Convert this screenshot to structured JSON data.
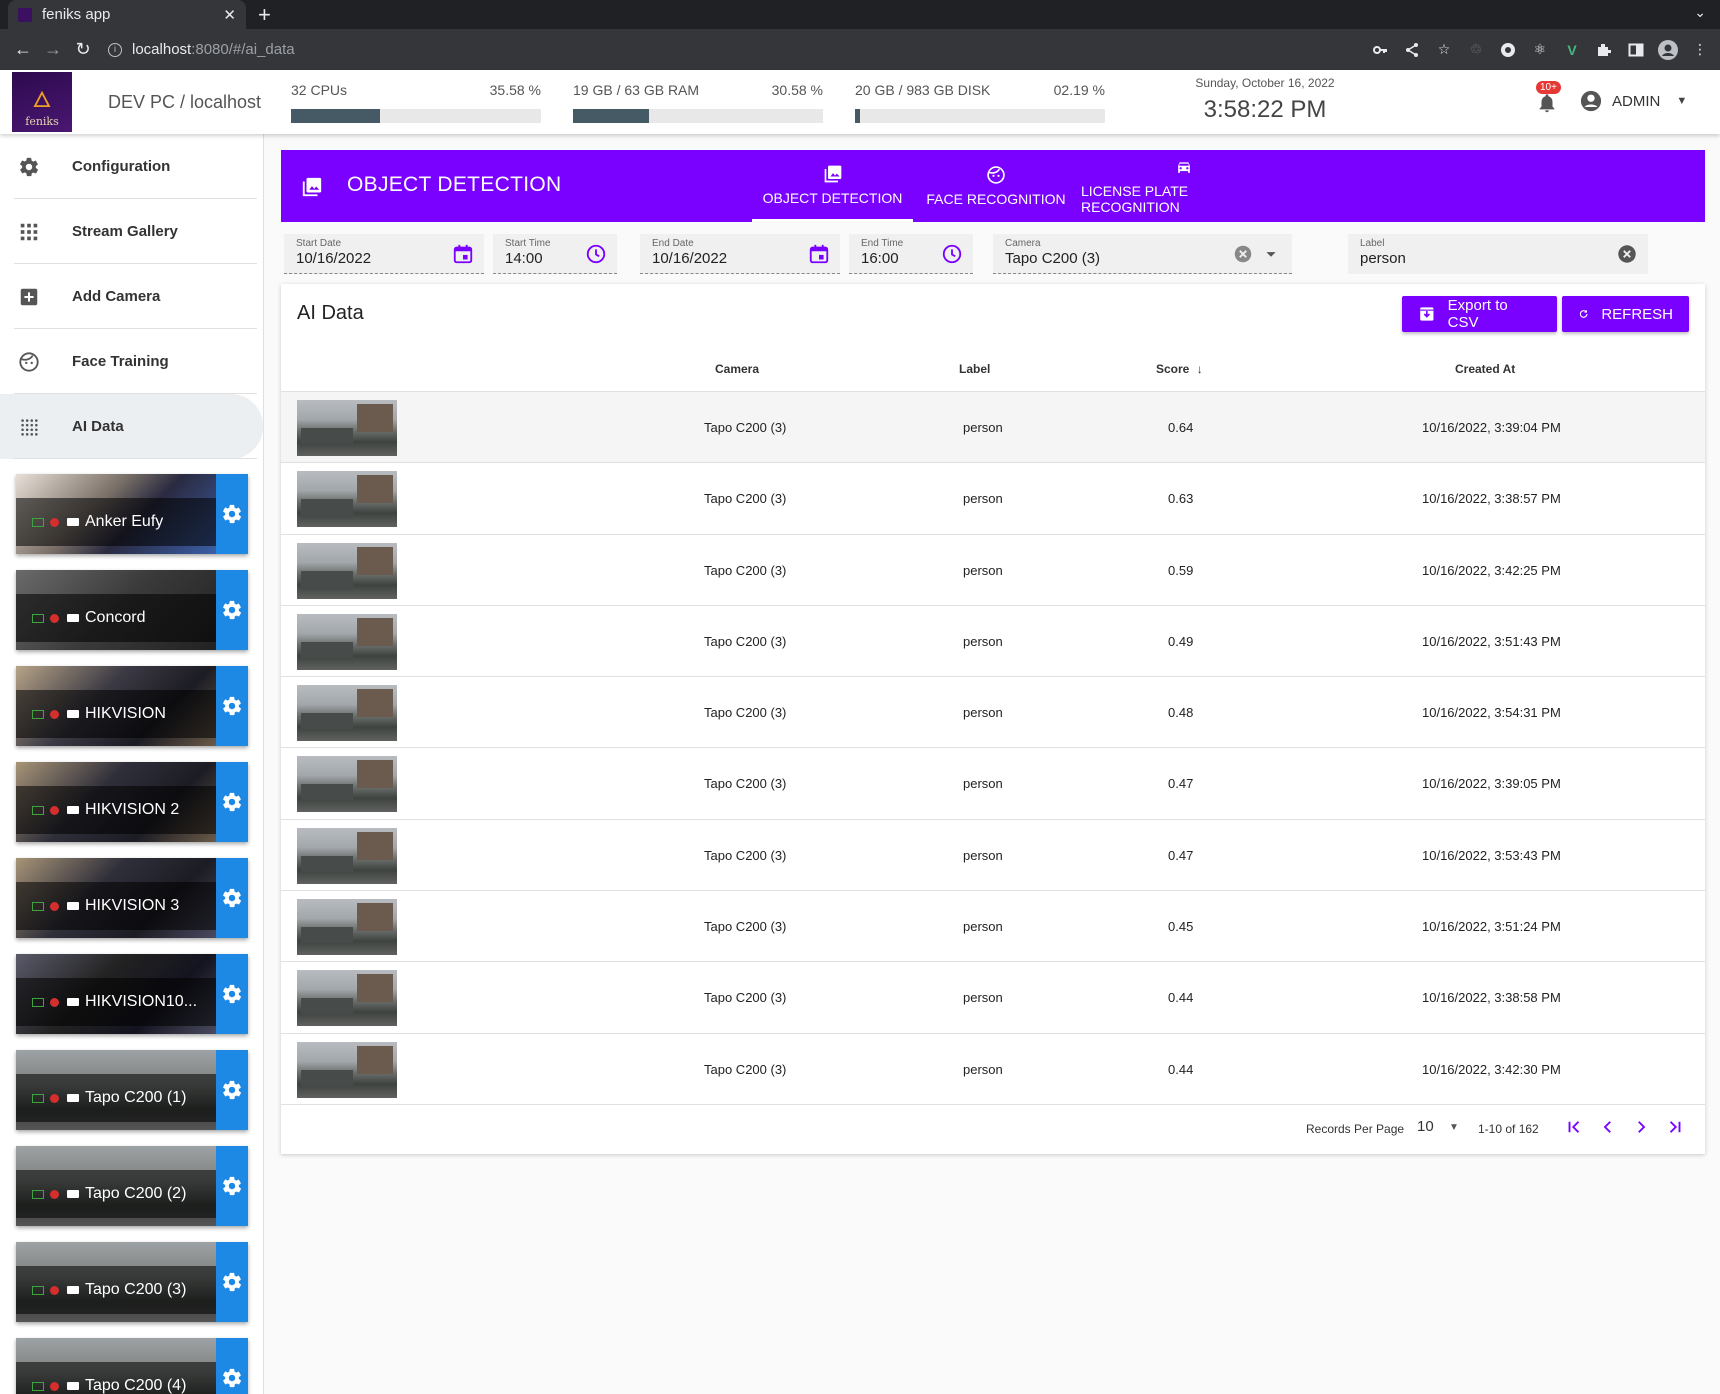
{
  "browser": {
    "tab_title": "feniks app",
    "tab_close": "✕",
    "new_tab": "+",
    "url_host": "localhost",
    "url_path": ":8080/#/ai_data"
  },
  "app_bar": {
    "logo_text": "feniks",
    "host": "DEV PC / localhost",
    "cpu": {
      "label": "32 CPUs",
      "percent_text": "35.58 %",
      "value": 35.58
    },
    "ram": {
      "label": "19 GB / 63 GB RAM",
      "percent_text": "30.58 %",
      "value": 30.58
    },
    "disk": {
      "label": "20 GB / 983 GB DISK",
      "percent_text": "02.19 %",
      "value": 2.19
    },
    "date": "Sunday, October 16, 2022",
    "time": "3:58:22 PM",
    "notification_badge": "10+",
    "user": "ADMIN"
  },
  "sidebar": {
    "items": [
      {
        "label": "Configuration",
        "icon": "gear-icon"
      },
      {
        "label": "Stream Gallery",
        "icon": "grid-icon"
      },
      {
        "label": "Add Camera",
        "icon": "add-box-icon"
      },
      {
        "label": "Face Training",
        "icon": "face-icon"
      },
      {
        "label": "AI Data",
        "icon": "dots-grid-icon",
        "active": true
      }
    ],
    "cameras": [
      "Anker Eufy",
      "Concord",
      "HIKVISION",
      "HIKVISION 2",
      "HIKVISION 3",
      "HIKVISION10...",
      "Tapo C200 (1)",
      "Tapo C200 (2)",
      "Tapo C200 (3)",
      "Tapo C200 (4)"
    ]
  },
  "header": {
    "title": "OBJECT DETECTION",
    "tabs": [
      {
        "label": "OBJECT DETECTION",
        "icon": "image-icon",
        "active": true
      },
      {
        "label": "FACE RECOGNITION",
        "icon": "face-icon"
      },
      {
        "label": "LICENSE PLATE RECOGNITION",
        "icon": "car-icon"
      }
    ]
  },
  "filters": {
    "start_date": {
      "label": "Start Date",
      "value": "10/16/2022"
    },
    "start_time": {
      "label": "Start Time",
      "value": "14:00"
    },
    "end_date": {
      "label": "End Date",
      "value": "10/16/2022"
    },
    "end_time": {
      "label": "End Time",
      "value": "16:00"
    },
    "camera": {
      "label": "Camera",
      "value": "Tapo C200 (3)"
    },
    "label": {
      "label": "Label",
      "value": "person"
    }
  },
  "table": {
    "title": "AI Data",
    "export_label": "Export to CSV",
    "refresh_label": "REFRESH",
    "headers": {
      "camera": "Camera",
      "label": "Label",
      "score": "Score",
      "created": "Created At"
    },
    "rows": [
      {
        "camera": "Tapo C200 (3)",
        "label": "person",
        "score": "0.64",
        "created": "10/16/2022, 3:39:04 PM"
      },
      {
        "camera": "Tapo C200 (3)",
        "label": "person",
        "score": "0.63",
        "created": "10/16/2022, 3:38:57 PM"
      },
      {
        "camera": "Tapo C200 (3)",
        "label": "person",
        "score": "0.59",
        "created": "10/16/2022, 3:42:25 PM"
      },
      {
        "camera": "Tapo C200 (3)",
        "label": "person",
        "score": "0.49",
        "created": "10/16/2022, 3:51:43 PM"
      },
      {
        "camera": "Tapo C200 (3)",
        "label": "person",
        "score": "0.48",
        "created": "10/16/2022, 3:54:31 PM"
      },
      {
        "camera": "Tapo C200 (3)",
        "label": "person",
        "score": "0.47",
        "created": "10/16/2022, 3:39:05 PM"
      },
      {
        "camera": "Tapo C200 (3)",
        "label": "person",
        "score": "0.47",
        "created": "10/16/2022, 3:53:43 PM"
      },
      {
        "camera": "Tapo C200 (3)",
        "label": "person",
        "score": "0.45",
        "created": "10/16/2022, 3:51:24 PM"
      },
      {
        "camera": "Tapo C200 (3)",
        "label": "person",
        "score": "0.44",
        "created": "10/16/2022, 3:38:58 PM"
      },
      {
        "camera": "Tapo C200 (3)",
        "label": "person",
        "score": "0.44",
        "created": "10/16/2022, 3:42:30 PM"
      }
    ],
    "records_per_page_label": "Records Per Page",
    "records_per_page": "10",
    "range": "1-10 of 162"
  },
  "colors": {
    "accent": "#7a00ff",
    "camera_settings": "#1e88e5",
    "meter_fill": "#455a64"
  }
}
